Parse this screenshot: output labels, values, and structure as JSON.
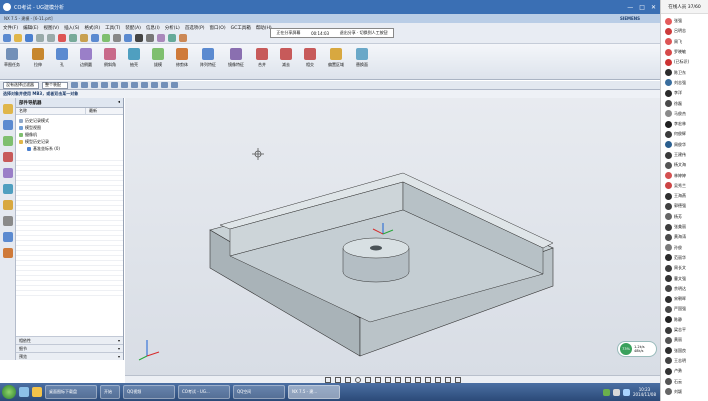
{
  "title_bar": {
    "text": "CO考试 - UG建模分析",
    "controls": [
      "—",
      "□",
      "✕"
    ]
  },
  "nx_bar": {
    "left_text": "NX 7.5 - 建模 - [6-11.prt]",
    "brand": "SIEMENS"
  },
  "float_bar": {
    "items": [
      "正在分享屏幕",
      "00:14:03",
      "退出分享 · 切换到人工按钮"
    ]
  },
  "menu": [
    "文件(F)",
    "编辑(E)",
    "视图(V)",
    "插入(S)",
    "格式(R)",
    "工具(T)",
    "装配(A)",
    "信息(I)",
    "分析(L)",
    "首选项(P)",
    "窗口(O)",
    "GC工具箱",
    "帮助(H)"
  ],
  "ribbon": {
    "buttons": [
      "草图任务",
      "拉伸",
      "孔",
      "边倒圆",
      "倒斜角",
      "抽壳",
      "拔模",
      "修剪体",
      "阵列特征",
      "镜像特征",
      "合并",
      "减去",
      "相交",
      "偏置区域",
      "替换面"
    ]
  },
  "filter_bar": {
    "filter": "没有选择过滤器",
    "scope": "整个装配"
  },
  "breadcrumb": "选择对象并使用 MB3，或者双击某一对象",
  "nav": {
    "title": "部件导航器",
    "col_name": "名称",
    "col_latest": "最新",
    "tree": [
      {
        "label": "历史记录模式",
        "color": "#8fa8c8"
      },
      {
        "label": "模型视图",
        "color": "#6f9fd8"
      },
      {
        "label": "摄像机",
        "color": "#7fbf6f"
      },
      {
        "label": "模型历史记录",
        "color": "#e0b64a"
      },
      {
        "label": "基准坐标系 (0)",
        "color": "#4a7fcf"
      }
    ],
    "bottom": [
      "相依性",
      "细节",
      "预览"
    ]
  },
  "right_panel": {
    "header": "在线人员 37/60",
    "users": [
      {
        "name": "张强",
        "color": "#e45b5b"
      },
      {
        "name": "吕明志",
        "color": "#cc3a3a"
      },
      {
        "name": "周飞",
        "color": "#dd5555"
      },
      {
        "name": "罗晓敏",
        "color": "#d64a4a"
      },
      {
        "name": "(已标识)",
        "color": "#c33"
      },
      {
        "name": "陈卫东",
        "color": "#2c2c2c"
      },
      {
        "name": "刘志强",
        "color": "#3a6e9e"
      },
      {
        "name": "李洋",
        "color": "#2a2a2a"
      },
      {
        "name": "徐磊",
        "color": "#4a4a4a"
      },
      {
        "name": "马俊杰",
        "color": "#8a8a8a"
      },
      {
        "name": "李宏林",
        "color": "#1f1f1f"
      },
      {
        "name": "何俊辉",
        "color": "#3b3b3b"
      },
      {
        "name": "周俊华",
        "color": "#2b5f8f"
      },
      {
        "name": "王建伟",
        "color": "#3a3a3a"
      },
      {
        "name": "杨文海",
        "color": "#555"
      },
      {
        "name": "林婷婷",
        "color": "#d45050"
      },
      {
        "name": "吴秀兰",
        "color": "#c44"
      },
      {
        "name": "王海燕",
        "color": "#2e2e2e"
      },
      {
        "name": "郭德强",
        "color": "#404040"
      },
      {
        "name": "杨芳",
        "color": "#666"
      },
      {
        "name": "张美丽",
        "color": "#3d3d3d"
      },
      {
        "name": "黄海涛",
        "color": "#4b4b4b"
      },
      {
        "name": "孙俊",
        "color": "#7a7a7a"
      },
      {
        "name": "范丽华",
        "color": "#2a2a2a"
      },
      {
        "name": "周长文",
        "color": "#3c3c3c"
      },
      {
        "name": "曹文强",
        "color": "#333"
      },
      {
        "name": "余明达",
        "color": "#444"
      },
      {
        "name": "宋朝晖",
        "color": "#2d2d2d"
      },
      {
        "name": "严国强",
        "color": "#484848"
      },
      {
        "name": "陈静",
        "color": "#222"
      },
      {
        "name": "梁志平",
        "color": "#3a3a3a"
      },
      {
        "name": "黄丽",
        "color": "#555"
      },
      {
        "name": "张国良",
        "color": "#2e2e2e"
      },
      {
        "name": "王志明",
        "color": "#444"
      },
      {
        "name": "卢勇",
        "color": "#333"
      },
      {
        "name": "石云",
        "color": "#555"
      },
      {
        "name": "刘颖",
        "color": "#666"
      }
    ]
  },
  "net_widget": {
    "percent": "73%",
    "up": "1.2k/s",
    "down": "48k/s"
  },
  "taskbar": {
    "tasks": [
      "桌面图标下载盘",
      "开始",
      "QQ视频",
      "CO考试 - UG...",
      "QQ空间",
      "NX 7.5 - 建..."
    ],
    "time": "10:23",
    "date": "2014/11/08"
  }
}
